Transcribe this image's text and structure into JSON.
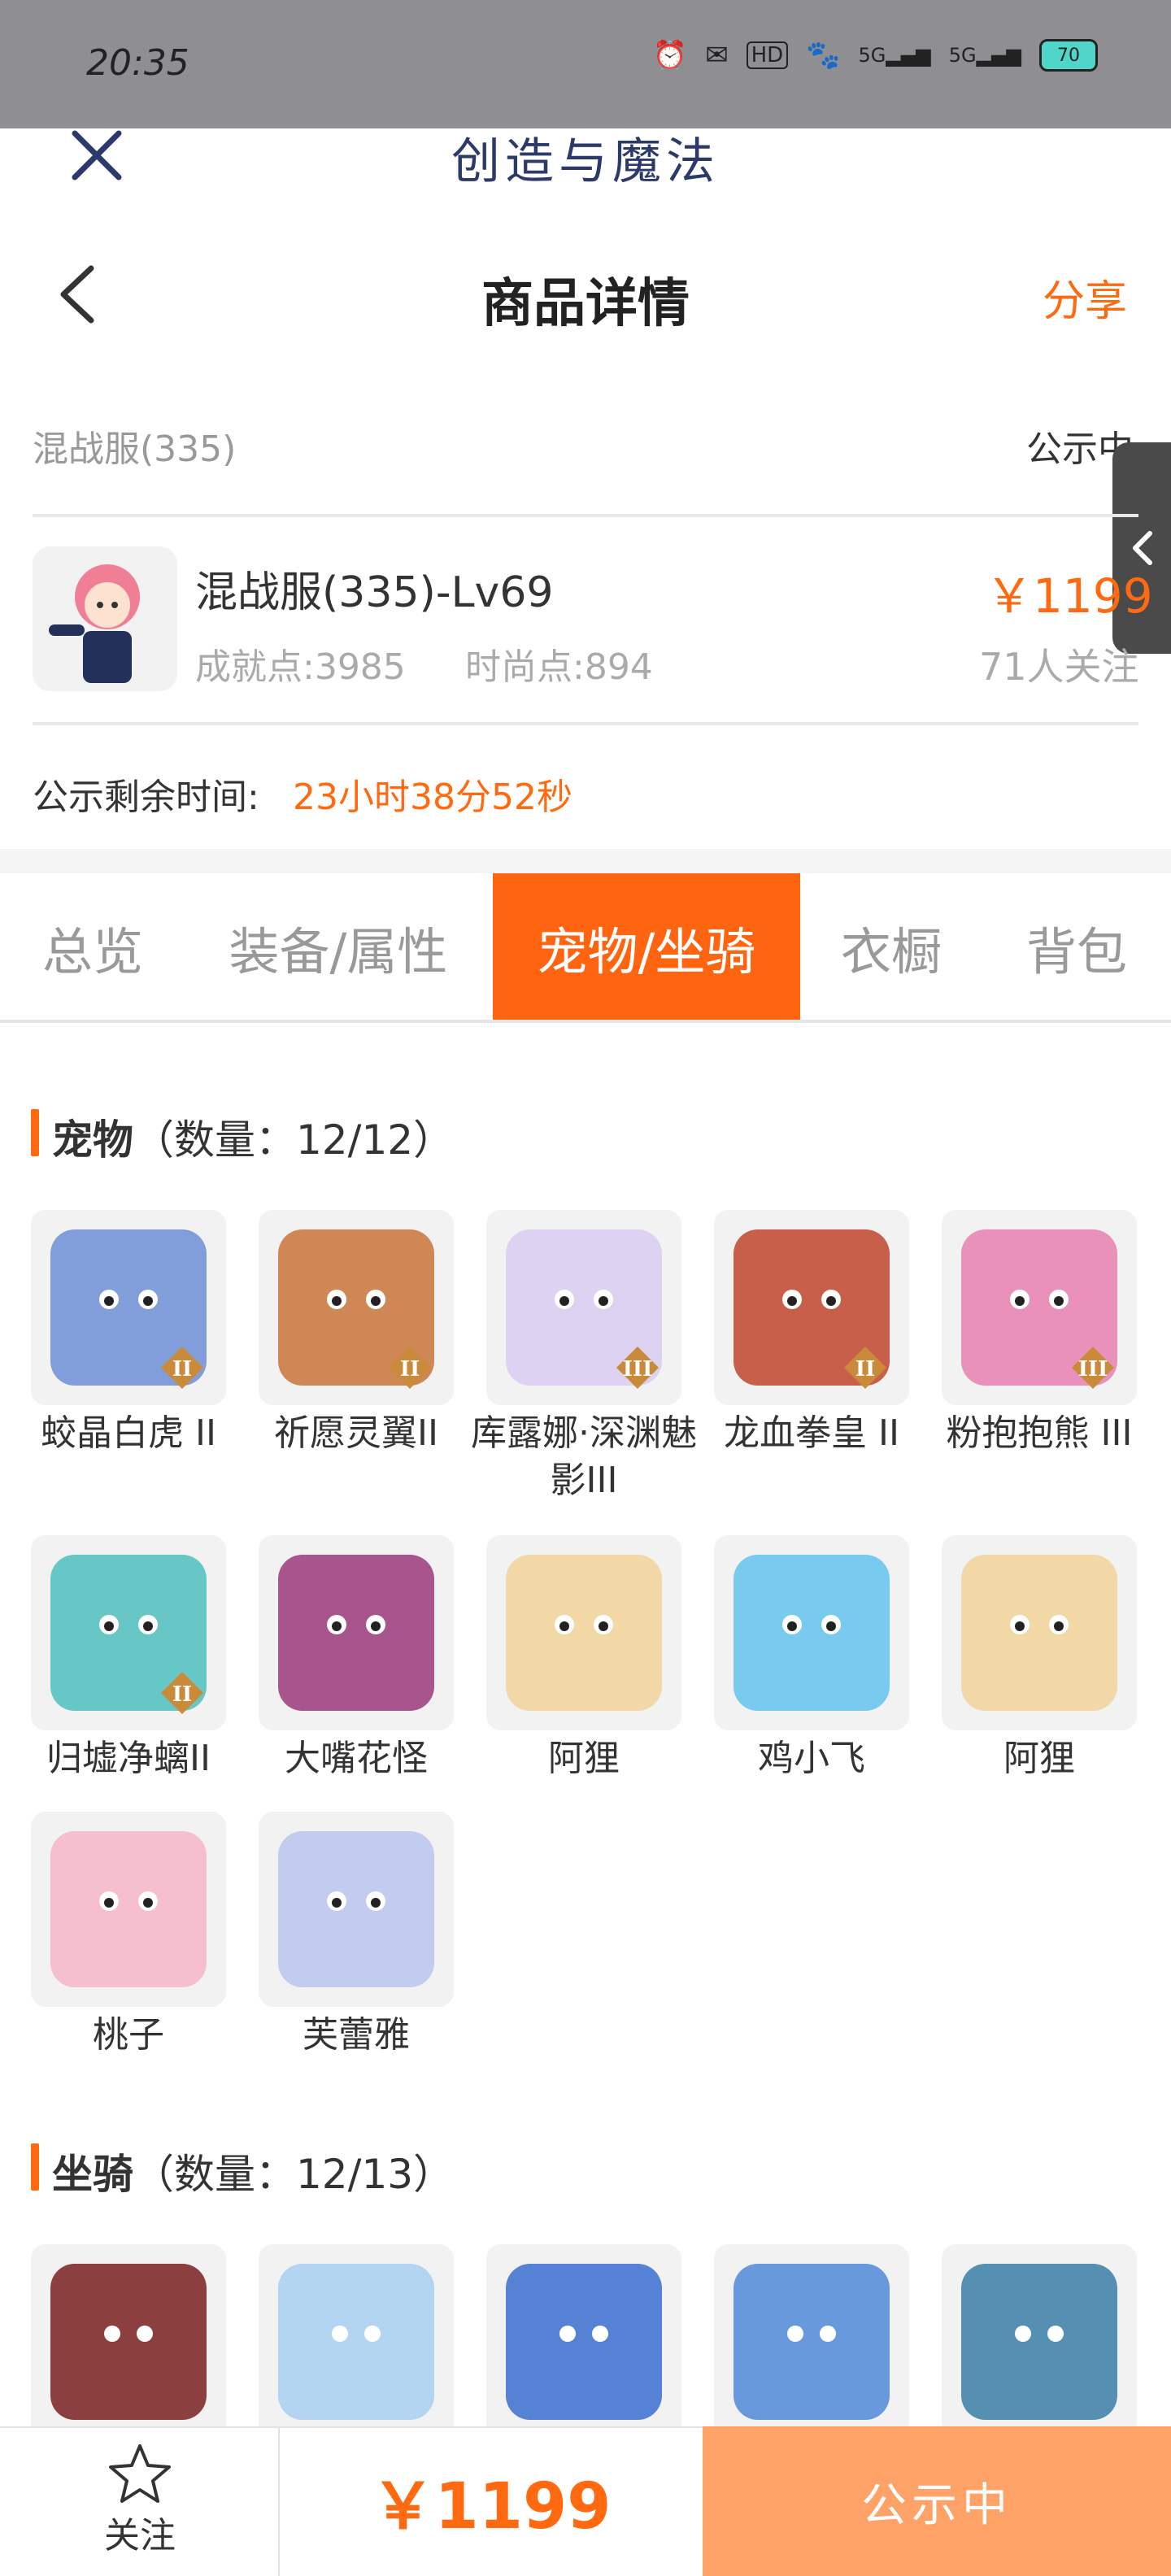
{
  "status_bar": {
    "time": "20:35",
    "battery": "70",
    "signal1": "5G",
    "signal2": "5G"
  },
  "app": {
    "title": "创造与魔法",
    "page_title": "商品详情",
    "share_label": "分享"
  },
  "listing": {
    "server": "混战服(335)",
    "status": "公示中",
    "name": "混战服(335)-Lv69",
    "achievement": "成就点:3985",
    "fashion": "时尚点:894",
    "price": "￥1199",
    "followers": "71人关注",
    "remain_label": "公示剩余时间:",
    "remain_value": "23小时38分52秒"
  },
  "tabs": [
    {
      "label": "总览",
      "active": false
    },
    {
      "label": "装备/属性",
      "active": false
    },
    {
      "label": "宠物/坐骑",
      "active": true
    },
    {
      "label": "衣橱",
      "active": false
    },
    {
      "label": "背包",
      "active": false
    }
  ],
  "pets_section": {
    "title": "宠物",
    "count": "（数量：12/12）",
    "items": [
      {
        "name": "蛟晶白虎 II",
        "badge": "II",
        "color": "#6f8fd6"
      },
      {
        "name": "祈愿灵翼II",
        "badge": "II",
        "color": "#c9743a"
      },
      {
        "name": "库露娜·深渊魅影III",
        "badge": "III",
        "color": "#d9cdf2"
      },
      {
        "name": "龙血拳皇 II",
        "badge": "II",
        "color": "#c0452d"
      },
      {
        "name": "粉抱抱熊 III",
        "badge": "III",
        "color": "#e880b0"
      },
      {
        "name": "归墟净螭II",
        "badge": "II",
        "color": "#4fc0c0"
      },
      {
        "name": "大嘴花怪",
        "badge": "",
        "color": "#9a3a7a"
      },
      {
        "name": "阿狸",
        "badge": "",
        "color": "#f2d39a"
      },
      {
        "name": "鸡小飞",
        "badge": "",
        "color": "#63c4ef"
      },
      {
        "name": "阿狸",
        "badge": "",
        "color": "#f2d39a"
      },
      {
        "name": "桃子",
        "badge": "",
        "color": "#f7b6c8"
      },
      {
        "name": "芙蕾雅",
        "badge": "",
        "color": "#b9c6ee"
      }
    ]
  },
  "mounts_section": {
    "title": "坐骑",
    "count": "（数量：12/13）",
    "items": [
      {
        "color": "#7a2020"
      },
      {
        "color": "#a8d0f2"
      },
      {
        "color": "#3a6fd0"
      },
      {
        "color": "#4f8ad8"
      },
      {
        "color": "#3a7fa8"
      }
    ]
  },
  "bottom_bar": {
    "follow_label": "关注",
    "price": "￥1199",
    "status": "公示中"
  }
}
